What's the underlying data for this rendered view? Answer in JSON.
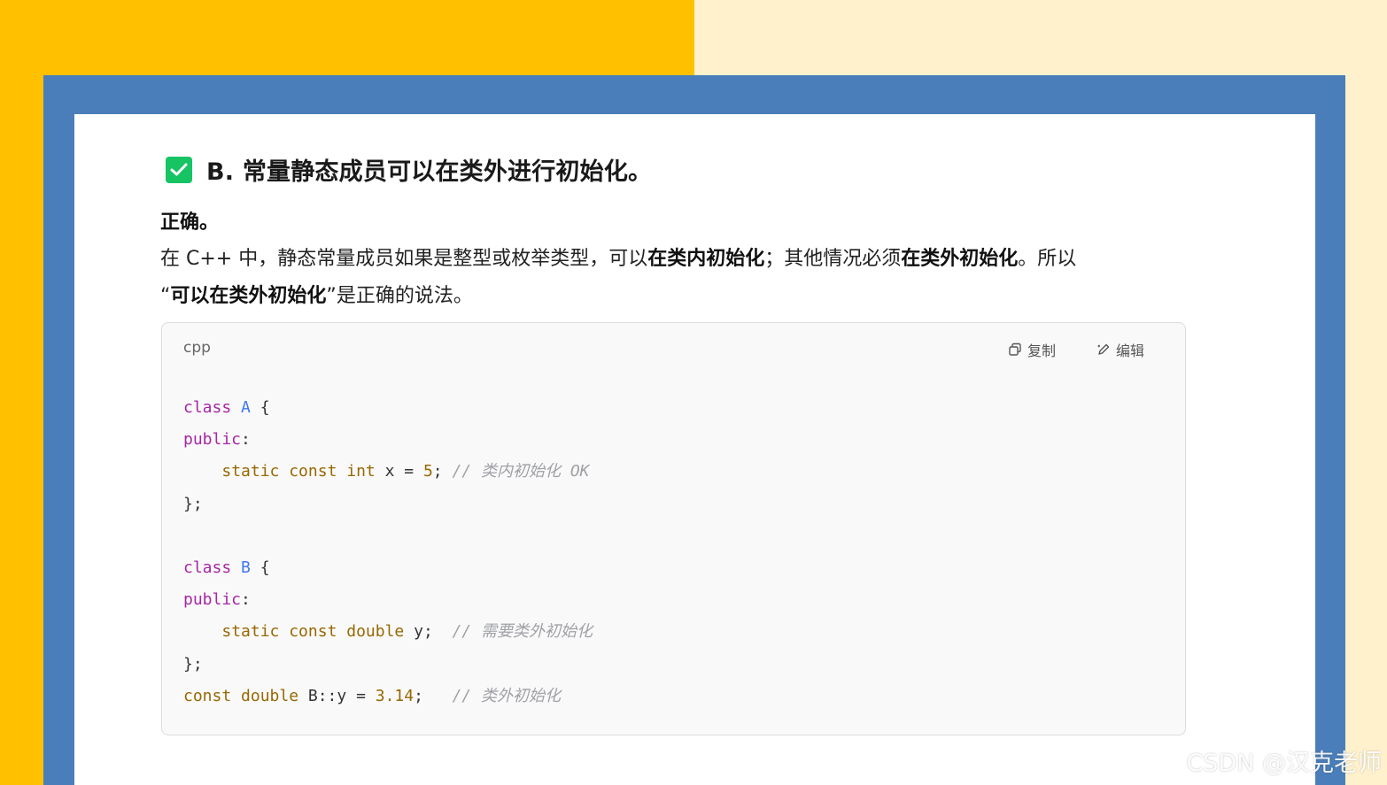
{
  "heading": {
    "text": "B. 常量静态成员可以在类外进行初始化。"
  },
  "verdict": "正确。",
  "explanation": {
    "p1": "在 C++ 中，静态常量成员如果是整型或枚举类型，可以",
    "b1": "在类内初始化",
    "p2": "；其他情况必须",
    "b2": "在类外初始化",
    "p3": "。所以",
    "q_open": "“",
    "b3": "可以在类外初始化",
    "p4": "”是正确的说法。"
  },
  "code_block": {
    "language": "cpp",
    "copy_label": "复制",
    "edit_label": "编辑",
    "lines": [
      {
        "kw": "class",
        "name": "A",
        "rest": " {"
      },
      {
        "kw": "public",
        "rest": ":"
      },
      {
        "indent": "    ",
        "ty": "static const int",
        "rest": " x = ",
        "num": "5",
        "end": "; ",
        "cm": "// 类内初始化 OK"
      },
      {
        "rest": "};"
      },
      {
        "rest": ""
      },
      {
        "kw": "class",
        "name": "B",
        "rest": " {"
      },
      {
        "kw": "public",
        "rest": ":"
      },
      {
        "indent": "    ",
        "ty": "static const double",
        "rest": " y;  ",
        "cm": "// 需要类外初始化"
      },
      {
        "rest": "};"
      },
      {
        "ty": "const double",
        "rest": " B::y = ",
        "num": "3.14",
        "end": ";   ",
        "cm": "// 类外初始化"
      }
    ]
  },
  "watermark": "CSDN @汉克老师",
  "colors": {
    "left_bg": "#FFC000",
    "right_bg": "#FFF1CC",
    "frame": "#4A7EBB",
    "check": "#16C464",
    "keyword": "#A626A4",
    "class_name": "#4078F2",
    "type": "#986801",
    "comment": "#A0A1A7"
  },
  "icons": [
    "check-square-icon",
    "copy-icon",
    "edit-pen-icon"
  ]
}
